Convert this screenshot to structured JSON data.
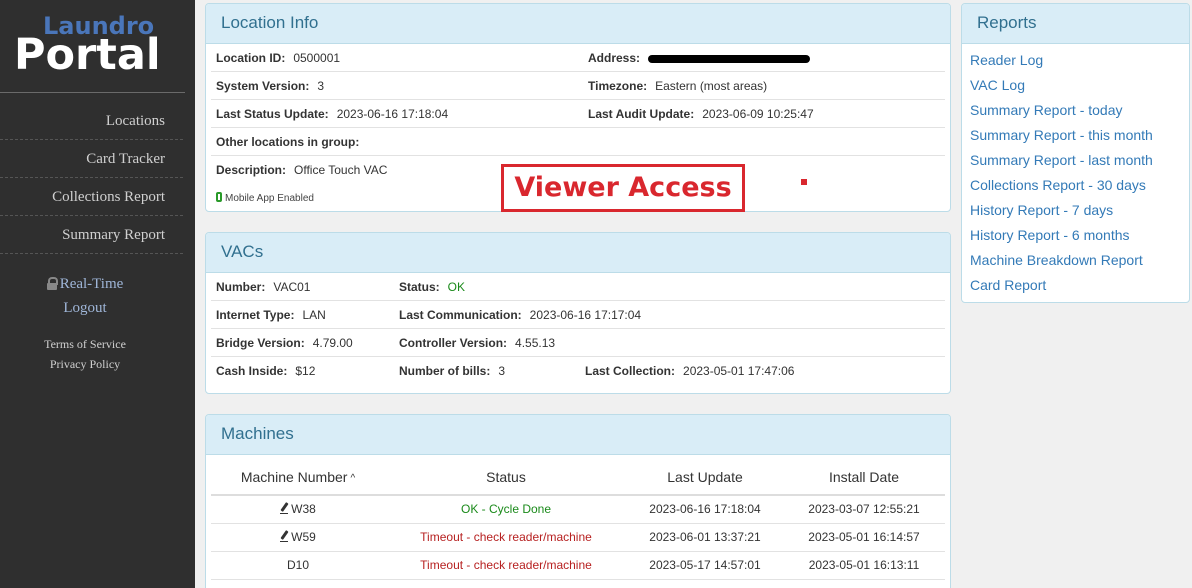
{
  "sidebar": {
    "logo_top": "Laundro",
    "logo_bottom": "Portal",
    "nav": [
      "Locations",
      "Card Tracker",
      "Collections Report",
      "Summary Report"
    ],
    "realtime": "Real-Time",
    "logout": "Logout",
    "terms": "Terms of Service",
    "privacy": "Privacy Policy"
  },
  "location": {
    "heading": "Location Info",
    "location_id_label": "Location ID:",
    "location_id": "0500001",
    "address_label": "Address:",
    "system_version_label": "System Version:",
    "system_version": "3",
    "timezone_label": "Timezone:",
    "timezone": "Eastern (most areas)",
    "last_status_label": "Last Status Update:",
    "last_status": "2023-06-16 17:18:04",
    "last_audit_label": "Last Audit Update:",
    "last_audit": "2023-06-09 10:25:47",
    "other_label": "Other locations in group:",
    "description_label": "Description:",
    "description": "Office Touch VAC",
    "mobile": "Mobile App Enabled"
  },
  "viewer_access": "Viewer Access",
  "vacs": {
    "heading": "VACs",
    "number_label": "Number:",
    "number": "VAC01",
    "status_label": "Status:",
    "status": "OK",
    "internet_label": "Internet Type:",
    "internet": "LAN",
    "last_comm_label": "Last Communication:",
    "last_comm": "2023-06-16 17:17:04",
    "bridge_label": "Bridge Version:",
    "bridge": "4.79.00",
    "controller_label": "Controller Version:",
    "controller": "4.55.13",
    "cash_label": "Cash Inside:",
    "cash": "$12",
    "bills_label": "Number of bills:",
    "bills": "3",
    "last_coll_label": "Last Collection:",
    "last_coll": "2023-05-01 17:47:06"
  },
  "machines": {
    "heading": "Machines",
    "columns": [
      "Machine Number",
      "Status",
      "Last Update",
      "Install Date"
    ],
    "rows": [
      {
        "number": "W38",
        "status": "OK - Cycle Done",
        "last_update": "2023-06-16 17:18:04",
        "install": "2023-03-07 12:55:21"
      },
      {
        "number": "W59",
        "status": "Timeout - check reader/machine",
        "last_update": "2023-06-01 13:37:21",
        "install": "2023-05-01 16:14:57"
      },
      {
        "number": "D10",
        "status": "Timeout - check reader/machine",
        "last_update": "2023-05-17 14:57:01",
        "install": "2023-05-01 16:13:11"
      }
    ]
  },
  "reports": {
    "heading": "Reports",
    "links": [
      "Reader Log",
      "VAC Log",
      "Summary Report - today",
      "Summary Report - this month",
      "Summary Report - last month",
      "Collections Report - 30 days",
      "History Report - 7 days",
      "History Report - 6 months",
      "Machine Breakdown Report",
      "Card Report"
    ]
  },
  "colors": {
    "sidebar_bg": "#2f2f2f",
    "panel_head_bg": "#d9edf7",
    "panel_head_text": "#31708f",
    "link": "#337ab7",
    "ok_green": "#1a8a1a",
    "timeout_red": "#b72121",
    "viewer_red": "#d9272e"
  }
}
